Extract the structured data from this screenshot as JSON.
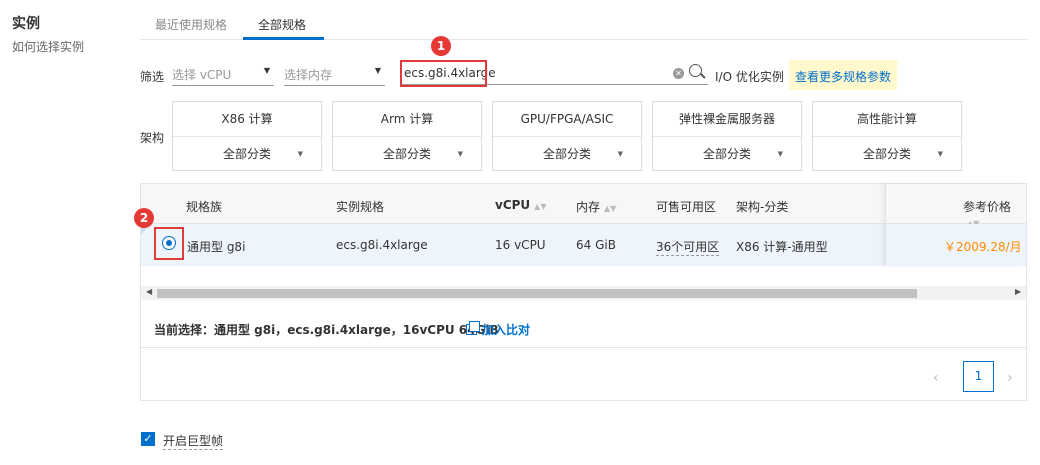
{
  "section": {
    "title": "实例",
    "help_link": "如何选择实例"
  },
  "tabs": [
    {
      "label": "最近使用规格",
      "active": false
    },
    {
      "label": "全部规格",
      "active": true
    }
  ],
  "filter": {
    "label": "筛选",
    "vcpu_placeholder": "选择 vCPU",
    "memory_placeholder": "选择内存",
    "search_value": "ecs.g8i.4xlarge",
    "io_optimized": "I/O 优化实例",
    "more_params": "查看更多规格参数"
  },
  "architecture": {
    "label": "架构",
    "options": [
      {
        "name": "X86 计算",
        "sub": "全部分类"
      },
      {
        "name": "Arm 计算",
        "sub": "全部分类"
      },
      {
        "name": "GPU/FPGA/ASIC",
        "sub": "全部分类"
      },
      {
        "name": "弹性裸金属服务器",
        "sub": "全部分类"
      },
      {
        "name": "高性能计算",
        "sub": "全部分类"
      }
    ]
  },
  "table": {
    "headers": {
      "family": "规格族",
      "spec": "实例规格",
      "vcpu": "vCPU",
      "memory": "内存",
      "zones": "可售可用区",
      "arch": "架构-分类",
      "price": "参考价格"
    },
    "rows": [
      {
        "selected": true,
        "family": "通用型 g8i",
        "spec": "ecs.g8i.4xlarge",
        "vcpu": "16 vCPU",
        "memory": "64 GiB",
        "zones": "36个可用区",
        "arch": "X86 计算-通用型",
        "price": "￥2009.28/月"
      }
    ]
  },
  "current_selection": "当前选择：通用型 g8i，ecs.g8i.4xlarge，16vCPU 64GiB",
  "add_compare": "加入比对",
  "pagination": {
    "current": "1"
  },
  "jumbo_frame": {
    "label": "开启巨型帧",
    "checked": true
  },
  "steps": {
    "one": "1",
    "two": "2"
  },
  "colors": {
    "accent": "#0070cc",
    "highlight": "#e03a3a",
    "price": "#ff8a00",
    "tip_bg": "#fff8cc"
  }
}
